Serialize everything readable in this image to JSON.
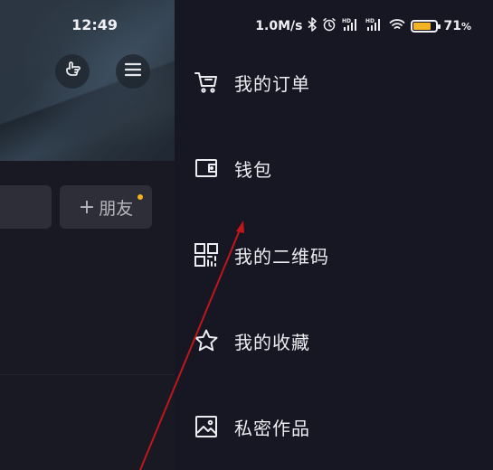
{
  "status_bar": {
    "time": "12:49",
    "network_speed": "1.0M/s",
    "battery": "71",
    "battery_unit": "%",
    "battery_level": 0.71,
    "icons": [
      "bluetooth-icon",
      "alarm-icon",
      "signal-hd-icon",
      "signal-hd-icon",
      "wifi-icon",
      "battery-icon"
    ]
  },
  "profile": {
    "add_friend_label": "朋友",
    "add_friend_prefix": "+"
  },
  "drawer": {
    "items": [
      {
        "label": "我的订单",
        "icon": "cart-icon"
      },
      {
        "label": "钱包",
        "icon": "wallet-icon"
      },
      {
        "label": "我的二维码",
        "icon": "qr-code-icon"
      },
      {
        "label": "我的收藏",
        "icon": "star-icon"
      },
      {
        "label": "私密作品",
        "icon": "private-image-icon"
      }
    ]
  },
  "colors": {
    "background": "#161722",
    "accent_dot": "#f5b221",
    "annotation_arrow": "#c0161c"
  }
}
